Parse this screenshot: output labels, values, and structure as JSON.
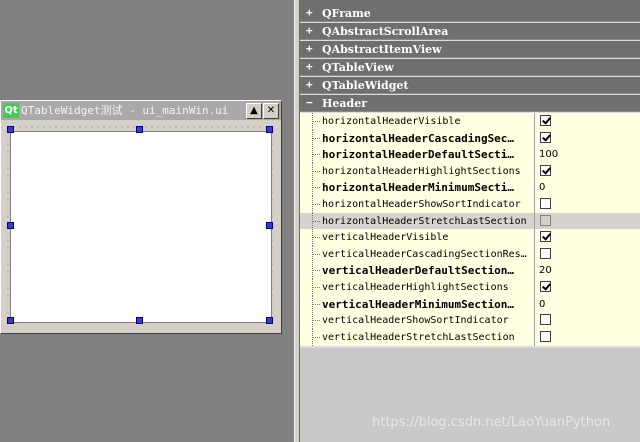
{
  "form": {
    "title": "QTableWidget测试 - ui_mainWin.ui",
    "logo": "Qt",
    "min_label": "▲",
    "close_label": "✕"
  },
  "property_groups": [
    {
      "label": "QFrame",
      "expander": "+"
    },
    {
      "label": "QAbstractScrollArea",
      "expander": "+"
    },
    {
      "label": "QAbstractItemView",
      "expander": "+"
    },
    {
      "label": "QTableView",
      "expander": "+"
    },
    {
      "label": "QTableWidget",
      "expander": "+"
    },
    {
      "label": "Header",
      "expander": "−"
    }
  ],
  "properties": [
    {
      "name": "horizontalHeaderVisible",
      "bold": false,
      "kind": "check",
      "checked": true
    },
    {
      "name": "horizontalHeaderCascadingSec…",
      "bold": true,
      "kind": "check",
      "checked": true
    },
    {
      "name": "horizontalHeaderDefaultSecti…",
      "bold": true,
      "kind": "text",
      "value": "100"
    },
    {
      "name": "horizontalHeaderHighlightSections",
      "bold": false,
      "kind": "check",
      "checked": true
    },
    {
      "name": "horizontalHeaderMinimumSecti…",
      "bold": true,
      "kind": "text",
      "value": "0"
    },
    {
      "name": "horizontalHeaderShowSortIndicator",
      "bold": false,
      "kind": "check",
      "checked": false
    },
    {
      "name": "horizontalHeaderStretchLastSection",
      "bold": false,
      "kind": "check",
      "checked": false,
      "selected": true
    },
    {
      "name": "verticalHeaderVisible",
      "bold": false,
      "kind": "check",
      "checked": true
    },
    {
      "name": "verticalHeaderCascadingSectionRes…",
      "bold": false,
      "kind": "check",
      "checked": false
    },
    {
      "name": "verticalHeaderDefaultSection…",
      "bold": true,
      "kind": "text",
      "value": "20"
    },
    {
      "name": "verticalHeaderHighlightSections",
      "bold": false,
      "kind": "check",
      "checked": true
    },
    {
      "name": "verticalHeaderMinimumSection…",
      "bold": true,
      "kind": "text",
      "value": "0"
    },
    {
      "name": "verticalHeaderShowSortIndicator",
      "bold": false,
      "kind": "check",
      "checked": false
    },
    {
      "name": "verticalHeaderStretchLastSection",
      "bold": false,
      "kind": "check",
      "checked": false
    }
  ],
  "watermark": "https://blog.csdn.net/LaoYuanPython",
  "colors": {
    "group_bg": "#6f6f6f",
    "row_bg": "#ffffe1",
    "selected_row_bg": "#d6d3ce",
    "qt_logo": "#41cd52"
  }
}
